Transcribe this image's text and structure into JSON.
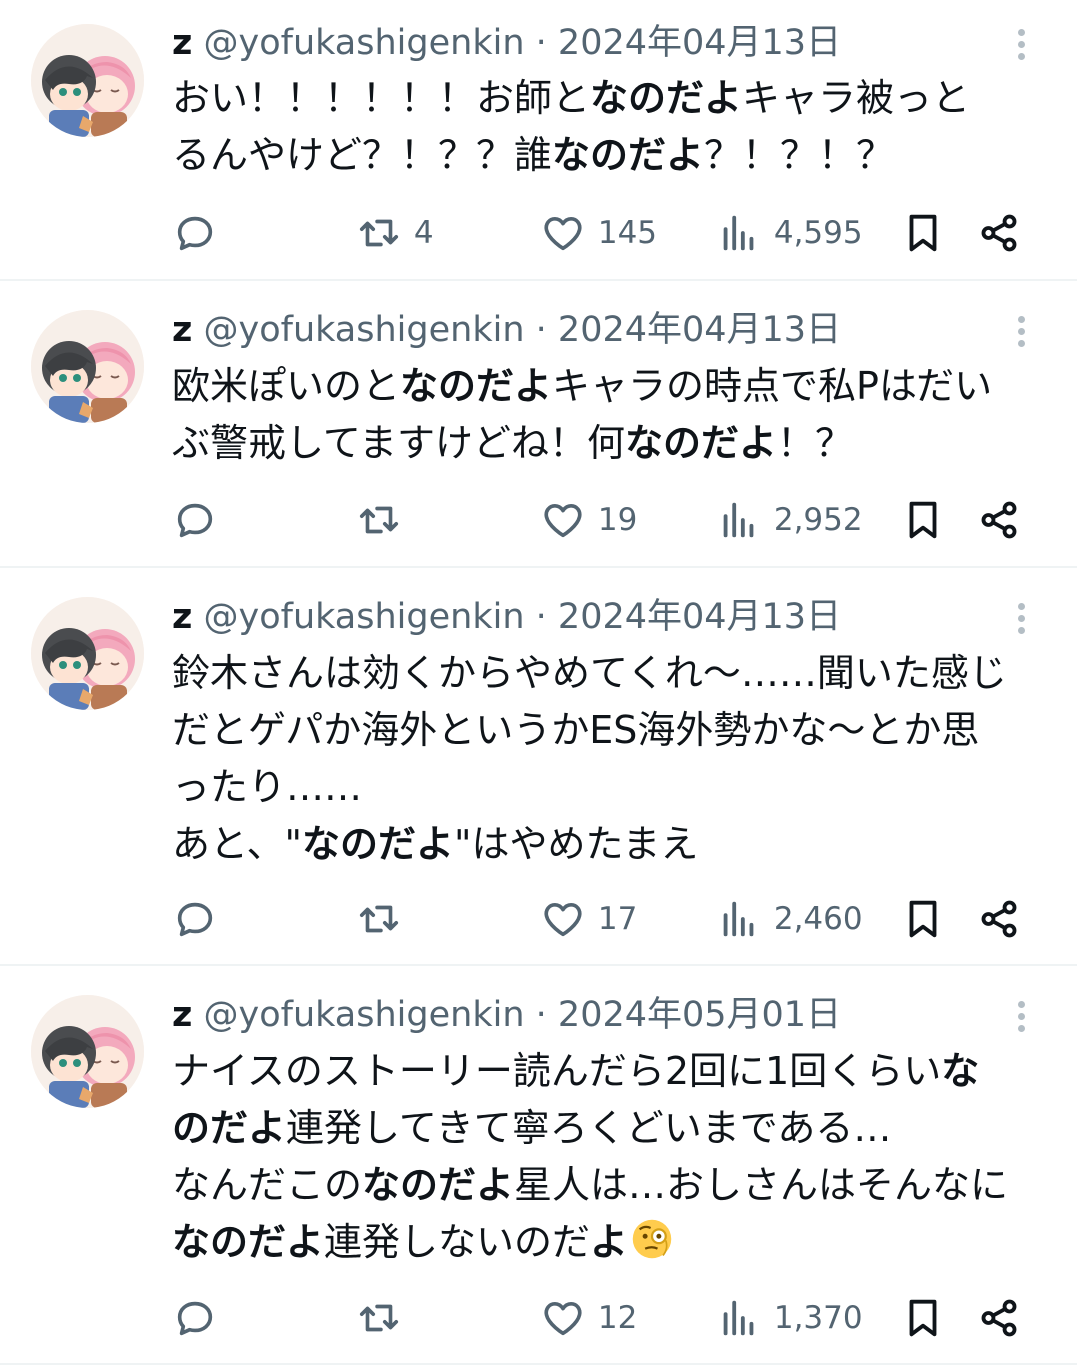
{
  "tweets": [
    {
      "display_name": "z",
      "handle": "@yofukashigenkin",
      "separator": "·",
      "date": "2024年04月13日",
      "lines": [
        [
          {
            "t": "おい！！！！！！お師と"
          },
          {
            "t": "なのだよ",
            "b": true
          },
          {
            "t": "キャラ被っと"
          }
        ],
        [
          {
            "t": "るんやけど？！？？誰"
          },
          {
            "t": "なのだよ",
            "b": true
          },
          {
            "t": "？！？！？"
          }
        ]
      ],
      "replies": "",
      "retweets": "4",
      "likes": "145",
      "views": "4,595"
    },
    {
      "display_name": "z",
      "handle": "@yofukashigenkin",
      "separator": "·",
      "date": "2024年04月13日",
      "lines": [
        [
          {
            "t": "欧米ぽいのと"
          },
          {
            "t": "なのだよ",
            "b": true
          },
          {
            "t": "キャラの時点で私Pはだい"
          }
        ],
        [
          {
            "t": "ぶ警戒してますけどね！何"
          },
          {
            "t": "なのだよ",
            "b": true
          },
          {
            "t": "！？"
          }
        ]
      ],
      "replies": "",
      "retweets": "",
      "likes": "19",
      "views": "2,952"
    },
    {
      "display_name": "z",
      "handle": "@yofukashigenkin",
      "separator": "·",
      "date": "2024年04月13日",
      "lines": [
        [
          {
            "t": "鈴木さんは効くからやめてくれ〜……聞いた感じ"
          }
        ],
        [
          {
            "t": "だとゲパか海外というかES海外勢かな〜とか思"
          }
        ],
        [
          {
            "t": "ったり……"
          }
        ],
        [
          {
            "t": "あと、\""
          },
          {
            "t": "なのだよ",
            "b": true
          },
          {
            "t": "\"はやめたまえ"
          }
        ]
      ],
      "replies": "",
      "retweets": "",
      "likes": "17",
      "views": "2,460"
    },
    {
      "display_name": "z",
      "handle": "@yofukashigenkin",
      "separator": "·",
      "date": "2024年05月01日",
      "lines": [
        [
          {
            "t": "ナイスのストーリー読んだら2回に1回くらい"
          },
          {
            "t": "な",
            "b": true
          }
        ],
        [
          {
            "t": "のだよ",
            "b": true
          },
          {
            "t": "連発してきて寧ろくどいまである…"
          }
        ],
        [
          {
            "t": "なんだこの"
          },
          {
            "t": "なのだよ",
            "b": true
          },
          {
            "t": "星人は…おしさんはそんなに"
          }
        ],
        [
          {
            "t": "なのだよ",
            "b": true
          },
          {
            "t": "連発しないのだ"
          },
          {
            "t": "よ",
            "b": true
          },
          {
            "emoji": "face-with-monocle"
          }
        ]
      ],
      "replies": "",
      "retweets": "",
      "likes": "12",
      "views": "1,370"
    }
  ],
  "icons": {
    "reply": "reply-icon",
    "retweet": "retweet-icon",
    "like": "heart-icon",
    "views": "views-icon",
    "bookmark": "bookmark-icon",
    "share": "share-icon",
    "more": "more-icon"
  },
  "colors": {
    "text": "#0f1419",
    "secondary": "#536471",
    "divider": "#eff3f4"
  }
}
